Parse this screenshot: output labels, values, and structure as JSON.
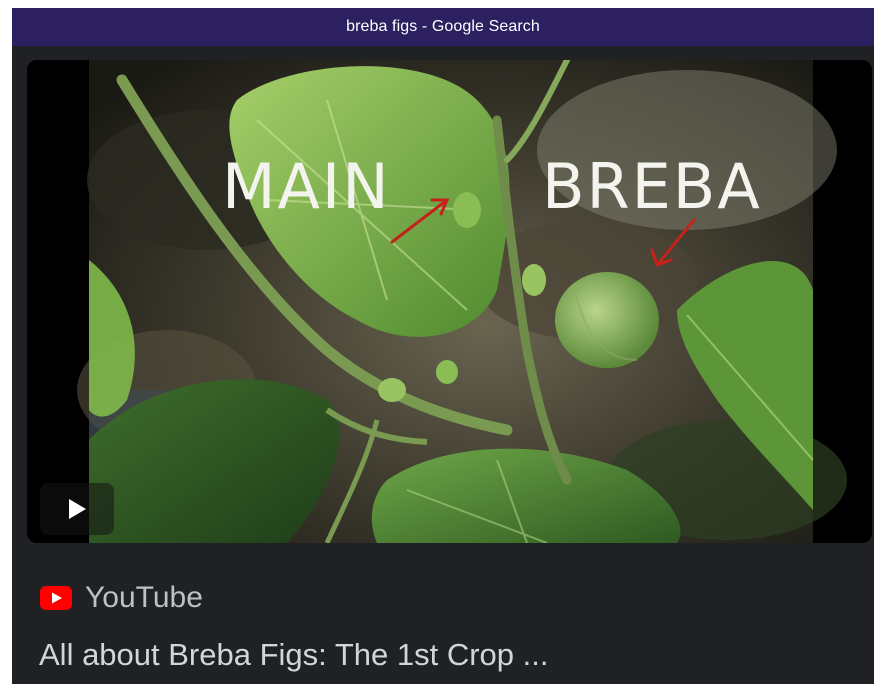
{
  "window": {
    "title": "breba figs - Google Search"
  },
  "video": {
    "overlay_text_left": "MAIN",
    "overlay_text_right": "BREBA",
    "play_icon": "play-icon"
  },
  "result": {
    "source_icon": "youtube-icon",
    "source_name": "YouTube",
    "title": "All about Breba Figs: The 1st Crop ..."
  },
  "colors": {
    "titlebar_bg": "#2d2060",
    "page_bg": "#202124",
    "youtube_red": "#ff0000",
    "arrow_red": "#c4231a"
  }
}
